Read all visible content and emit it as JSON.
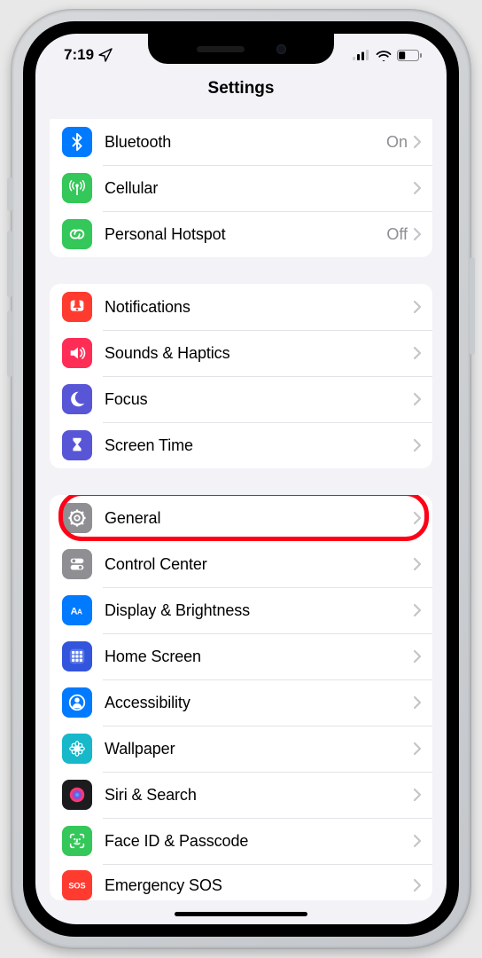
{
  "status": {
    "time": "7:19",
    "location_arrow": true
  },
  "nav": {
    "title": "Settings"
  },
  "groups": [
    {
      "rows": [
        {
          "id": "bluetooth",
          "label": "Bluetooth",
          "value": "On",
          "icon": "bluetooth",
          "color": "#007aff"
        },
        {
          "id": "cellular",
          "label": "Cellular",
          "icon": "antenna",
          "color": "#34c759"
        },
        {
          "id": "personal-hotspot",
          "label": "Personal Hotspot",
          "value": "Off",
          "icon": "link",
          "color": "#34c759"
        }
      ]
    },
    {
      "rows": [
        {
          "id": "notifications",
          "label": "Notifications",
          "icon": "bell",
          "color": "#ff3b30"
        },
        {
          "id": "sounds",
          "label": "Sounds & Haptics",
          "icon": "speaker",
          "color": "#ff2d55"
        },
        {
          "id": "focus",
          "label": "Focus",
          "icon": "moon",
          "color": "#5856d6"
        },
        {
          "id": "screentime",
          "label": "Screen Time",
          "icon": "hourglass",
          "color": "#5856d6"
        }
      ]
    },
    {
      "rows": [
        {
          "id": "general",
          "label": "General",
          "icon": "gear",
          "color": "#8e8e93",
          "highlighted": true
        },
        {
          "id": "control-center",
          "label": "Control Center",
          "icon": "switches",
          "color": "#8e8e93"
        },
        {
          "id": "display",
          "label": "Display & Brightness",
          "icon": "aa",
          "color": "#007aff"
        },
        {
          "id": "home-screen",
          "label": "Home Screen",
          "icon": "grid",
          "color": "#3355dd"
        },
        {
          "id": "accessibility",
          "label": "Accessibility",
          "icon": "person",
          "color": "#007aff"
        },
        {
          "id": "wallpaper",
          "label": "Wallpaper",
          "icon": "flower",
          "color": "#16b8c9"
        },
        {
          "id": "siri",
          "label": "Siri & Search",
          "icon": "siri",
          "color": "#1c1c1e"
        },
        {
          "id": "faceid",
          "label": "Face ID & Passcode",
          "icon": "faceid",
          "color": "#34c759"
        },
        {
          "id": "sos",
          "label": "Emergency SOS",
          "icon": "sos",
          "color": "#ff3b30",
          "partial": true
        }
      ]
    }
  ]
}
